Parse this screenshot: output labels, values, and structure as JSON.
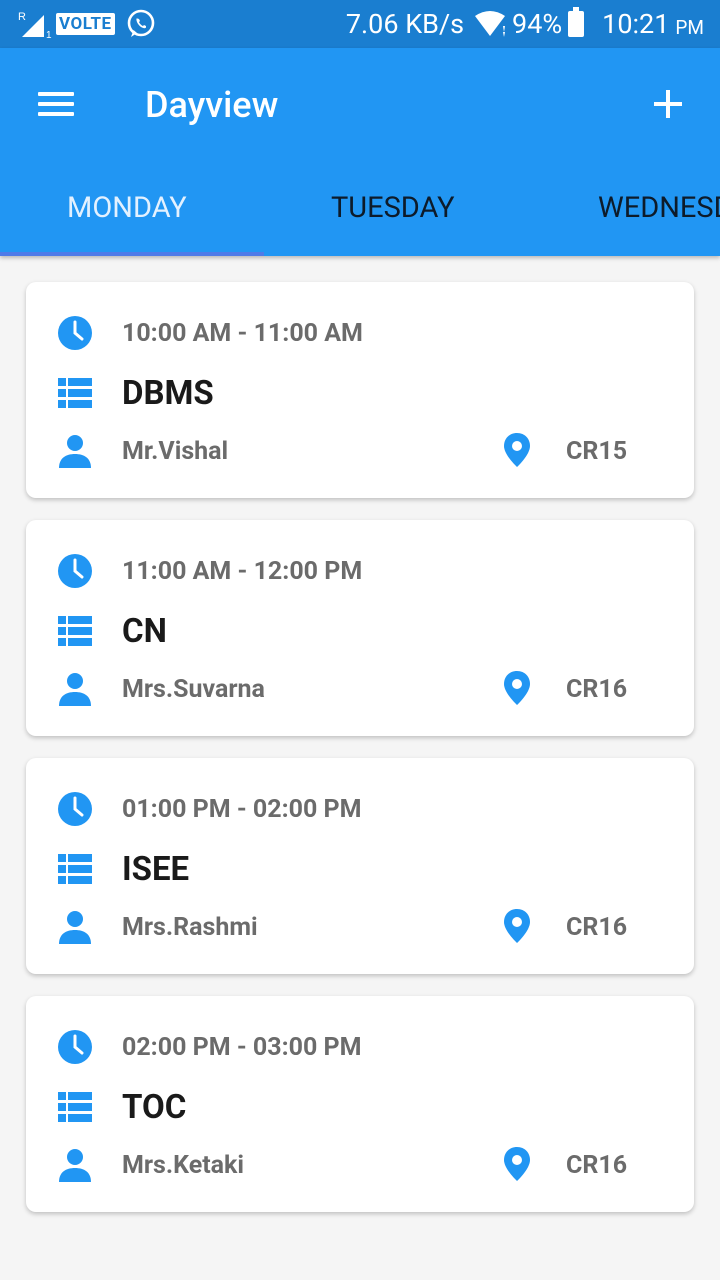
{
  "status_bar": {
    "volte": "VOLTE",
    "speed": "7.06 KB/s",
    "battery": "94%",
    "time": "10:21",
    "ampm": "PM"
  },
  "app_bar": {
    "title": "Dayview",
    "menu_icon": "menu-icon",
    "add_icon": "add-icon"
  },
  "tabs": [
    {
      "label": "MONDAY",
      "selected": true
    },
    {
      "label": "TUESDAY",
      "selected": false
    },
    {
      "label": "WEDNESDAY",
      "selected": false
    }
  ],
  "schedule": [
    {
      "time": "10:00 AM - 11:00 AM",
      "subject": "DBMS",
      "teacher": "Mr.Vishal",
      "room": "CR15"
    },
    {
      "time": "11:00 AM - 12:00 PM",
      "subject": "CN",
      "teacher": "Mrs.Suvarna",
      "room": "CR16"
    },
    {
      "time": "01:00 PM - 02:00 PM",
      "subject": "ISEE",
      "teacher": "Mrs.Rashmi",
      "room": "CR16"
    },
    {
      "time": "02:00 PM - 03:00 PM",
      "subject": "TOC",
      "teacher": "Mrs.Ketaki",
      "room": "CR16"
    }
  ],
  "colors": {
    "primary": "#2196f3",
    "status_bar": "#1a7ed0",
    "accent_icon": "#2196f3",
    "tab_indicator": "#4f7be8"
  }
}
